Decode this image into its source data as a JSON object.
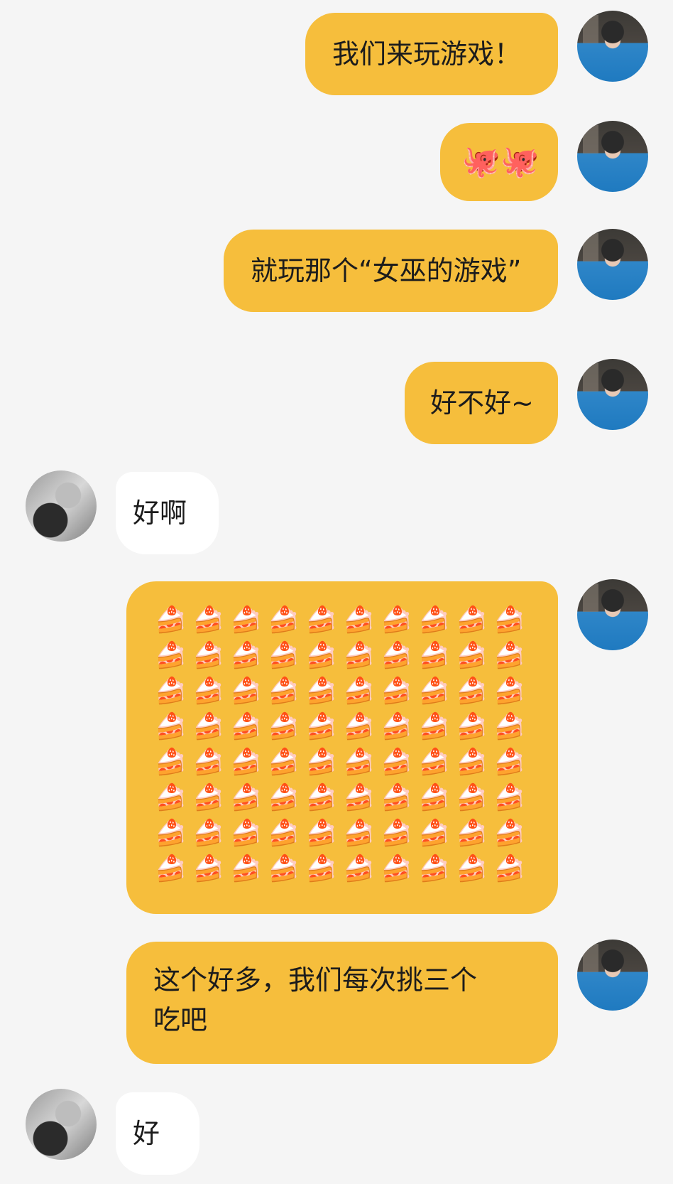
{
  "messages": [
    {
      "side": "me",
      "text": "我们来玩游戏！"
    },
    {
      "side": "me",
      "text": "🐙🐙"
    },
    {
      "side": "me",
      "text": "就玩那个“女巫的游戏”"
    },
    {
      "side": "me",
      "text": "好不好~"
    },
    {
      "side": "other",
      "text": "好啊"
    },
    {
      "side": "me",
      "cake_grid": {
        "emoji": "🍰",
        "rows": 8,
        "cols": 10
      }
    },
    {
      "side": "me",
      "text": "这个好多，我们每次挑三个\n吃吧"
    },
    {
      "side": "other",
      "text": "好"
    }
  ]
}
